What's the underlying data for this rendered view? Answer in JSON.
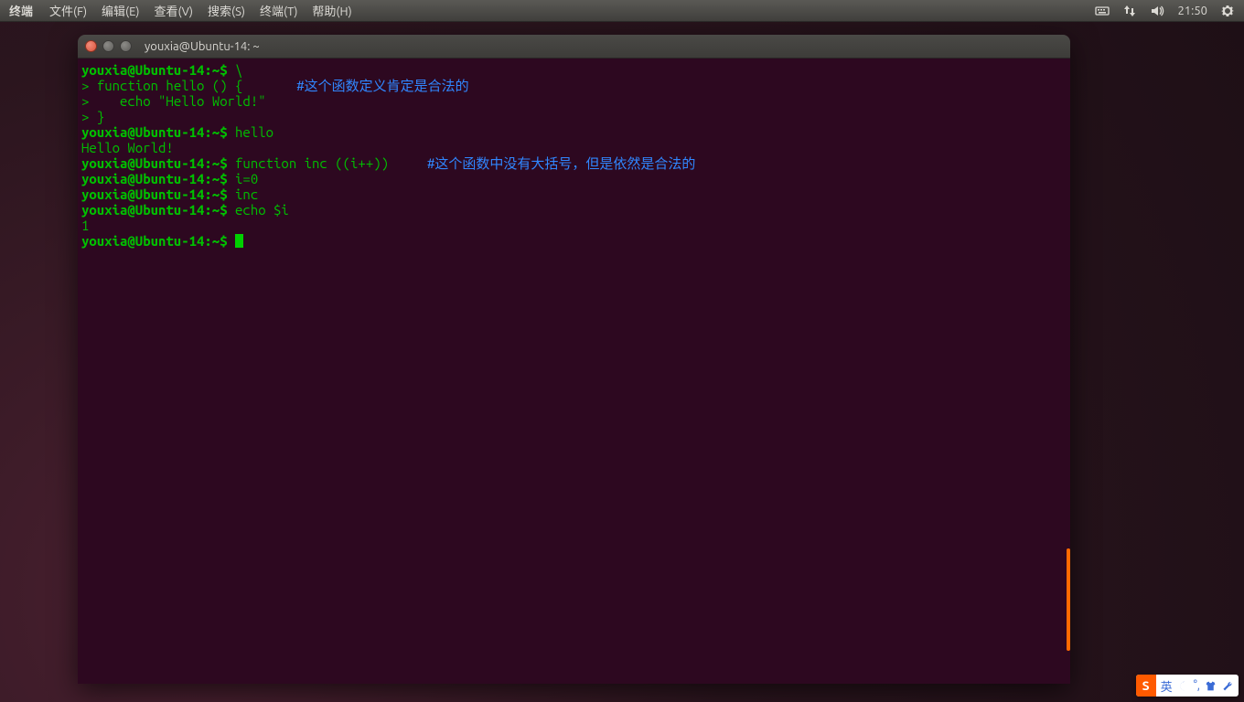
{
  "panel": {
    "app_label": "终端",
    "menus": [
      "文件(F)",
      "编辑(E)",
      "查看(V)",
      "搜索(S)",
      "终端(T)",
      "帮助(H)"
    ],
    "clock": "21:50"
  },
  "window": {
    "title": "youxia@Ubuntu-14: ~"
  },
  "term": {
    "prompt": "youxia@Ubuntu-14:~$ ",
    "cont": "> ",
    "lines": [
      {
        "prompt": true,
        "cmd": "\\"
      },
      {
        "cont": true,
        "cmd": "function hello () {       ",
        "comment": "#这个函数定义肯定是合法的"
      },
      {
        "cont": true,
        "cmd": "   echo \"Hello World!\""
      },
      {
        "cont": true,
        "cmd": "}"
      },
      {
        "prompt": true,
        "cmd": "hello"
      },
      {
        "out": "Hello World!"
      },
      {
        "prompt": true,
        "cmd": "function inc ((i++))     ",
        "comment": "#这个函数中没有大括号，但是依然是合法的"
      },
      {
        "prompt": true,
        "cmd": "i=0"
      },
      {
        "prompt": true,
        "cmd": "inc"
      },
      {
        "prompt": true,
        "cmd": "echo $i"
      },
      {
        "out": "1"
      },
      {
        "prompt": true,
        "cmd": "",
        "cursor": true
      }
    ]
  },
  "ime": {
    "logo": "S",
    "lang": "英"
  }
}
